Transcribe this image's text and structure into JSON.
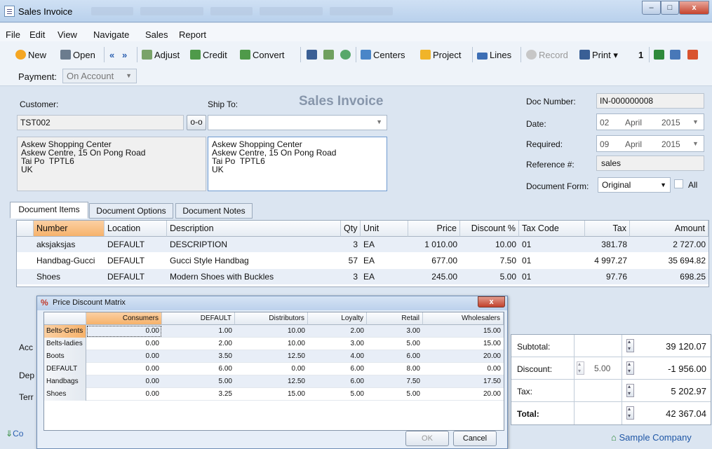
{
  "window": {
    "title": "Sales Invoice",
    "minimize": "–",
    "maximize": "□",
    "close": "x"
  },
  "menubar": [
    {
      "label": "File"
    },
    {
      "label": "Edit"
    },
    {
      "label": "View"
    },
    {
      "label": "Navigate"
    },
    {
      "label": "Sales"
    },
    {
      "label": "Report"
    }
  ],
  "toolbar": {
    "new": "New",
    "open": "Open",
    "adjust": "Adjust",
    "credit": "Credit",
    "convert": "Convert",
    "centers": "Centers",
    "project": "Project",
    "lines": "Lines",
    "record": "Record",
    "print": "Print",
    "print_count": "1"
  },
  "payment": {
    "label": "Payment:",
    "value": "On Account"
  },
  "form": {
    "customer_label": "Customer:",
    "customer_value": "TST002",
    "ship_to_label": "Ship To:",
    "heading": "Sales Invoice",
    "bill_address": "Askew Shopping Center\nAskew Centre, 15 On Pong Road\nTai Po  TPTL6\nUK",
    "ship_address": "Askew Shopping Center\nAskew Centre, 15 On Pong Road\nTai Po  TPTL6\nUK",
    "doc_number_label": "Doc Number:",
    "doc_number_value": "IN-000000008",
    "date_label": "Date:",
    "date_day": "02",
    "date_month": "April",
    "date_year": "2015",
    "required_label": "Required:",
    "required_day": "09",
    "required_month": "April",
    "required_year": "2015",
    "reference_label": "Reference #:",
    "reference_value": "sales",
    "doc_form_label": "Document Form:",
    "doc_form_value": "Original",
    "all_label": "All"
  },
  "tabs": [
    {
      "label": "Document Items"
    },
    {
      "label": "Document Options"
    },
    {
      "label": "Document Notes"
    }
  ],
  "grid": {
    "headers": {
      "number": "Number",
      "location": "Location",
      "description": "Description",
      "qty": "Qty",
      "unit": "Unit",
      "price": "Price",
      "discount": "Discount %",
      "taxcode": "Tax Code",
      "tax": "Tax",
      "amount": "Amount"
    },
    "rows": [
      {
        "number": "aksjaksjas",
        "location": "DEFAULT",
        "description": "DESCRIPTION",
        "qty": "3",
        "unit": "EA",
        "price": "1 010.00",
        "discount": "10.00",
        "taxcode": "01",
        "tax": "381.78",
        "amount": "2 727.00"
      },
      {
        "number": "Handbag-Gucci",
        "location": "DEFAULT",
        "description": "Gucci Style Handbag",
        "qty": "57",
        "unit": "EA",
        "price": "677.00",
        "discount": "7.50",
        "taxcode": "01",
        "tax": "4 997.27",
        "amount": "35 694.82"
      },
      {
        "number": "Shoes",
        "location": "DEFAULT",
        "description": "Modern Shoes with Buckles",
        "qty": "3",
        "unit": "EA",
        "price": "245.00",
        "discount": "5.00",
        "taxcode": "01",
        "tax": "97.76",
        "amount": "698.25"
      }
    ]
  },
  "bottom_left": {
    "acc": "Acc",
    "dep": "Dep",
    "ter": "Terr",
    "co": "Co"
  },
  "summary": {
    "subtotal_label": "Subtotal:",
    "subtotal_value": "39 120.07",
    "discount_label": "Discount:",
    "discount_pct": "5.00",
    "discount_value": "-1 956.00",
    "tax_label": "Tax:",
    "tax_value": "5 202.97",
    "total_label": "Total:",
    "total_value": "42 367.04"
  },
  "status": {
    "company": "Sample Company"
  },
  "dialog": {
    "title": "Price Discount Matrix",
    "columns": [
      "Consumers",
      "DEFAULT",
      "Distributors",
      "Loyalty",
      "Retail",
      "Wholesalers"
    ],
    "rows": [
      {
        "name": "Belts-Gents",
        "values": [
          "0.00",
          "1.00",
          "10.00",
          "2.00",
          "3.00",
          "15.00"
        ]
      },
      {
        "name": "Belts-ladies",
        "values": [
          "0.00",
          "2.00",
          "10.00",
          "3.00",
          "5.00",
          "15.00"
        ]
      },
      {
        "name": "Boots",
        "values": [
          "0.00",
          "3.50",
          "12.50",
          "4.00",
          "6.00",
          "20.00"
        ]
      },
      {
        "name": "DEFAULT",
        "values": [
          "0.00",
          "6.00",
          "0.00",
          "6.00",
          "8.00",
          "0.00"
        ]
      },
      {
        "name": "Handbags",
        "values": [
          "0.00",
          "5.00",
          "12.50",
          "6.00",
          "7.50",
          "17.50"
        ]
      },
      {
        "name": "Shoes",
        "values": [
          "0.00",
          "3.25",
          "15.00",
          "5.00",
          "5.00",
          "20.00"
        ]
      }
    ],
    "ok": "OK",
    "cancel": "Cancel"
  },
  "colors": {
    "accent_orange": "#f6b26b",
    "title_bar": "#bcd1ec",
    "grid_alt": "#e8eef7"
  }
}
